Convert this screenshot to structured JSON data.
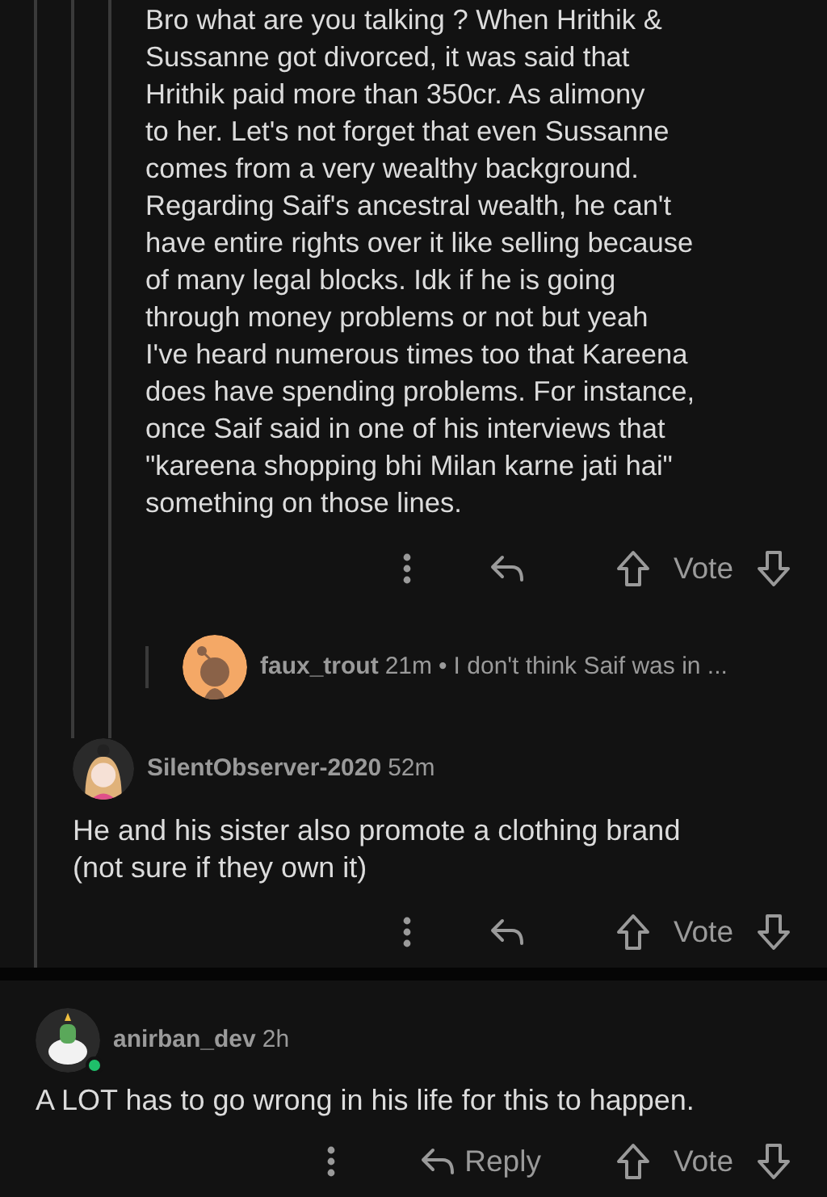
{
  "thread": {
    "body_lines": [
      "Bro what are you talking ? When Hrithik &",
      "Sussanne got divorced, it was said that",
      "Hrithik paid more than 350cr. As alimony",
      "to her. Let's not forget that even Sussanne",
      "comes from a very wealthy background.",
      "Regarding Saif's ancestral wealth, he can't",
      "have entire rights over it like selling because",
      "of many legal blocks. Idk if he is going",
      "through money problems or not but yeah",
      "I've heard numerous times too that Kareena",
      "does have spending problems. For instance,",
      "once Saif said in one of his interviews that",
      "\"kareena shopping bhi Milan karne jati hai\"",
      "something on those lines."
    ],
    "vote_label": "Vote"
  },
  "collapsed_reply": {
    "author": "faux_trout",
    "time": "21m",
    "separator": "•",
    "preview": "I don't think Saif was in ..."
  },
  "reply": {
    "author": "SilentObserver-2020",
    "time": "52m",
    "body_lines": [
      "He and his sister also promote a clothing brand",
      "(not sure if they own it)"
    ],
    "vote_label": "Vote"
  },
  "comment": {
    "author": "anirban_dev",
    "time": "2h",
    "online": true,
    "body": "A LOT has to go wrong in his life for this to happen.",
    "reply_label": "Reply",
    "vote_label": "Vote"
  }
}
